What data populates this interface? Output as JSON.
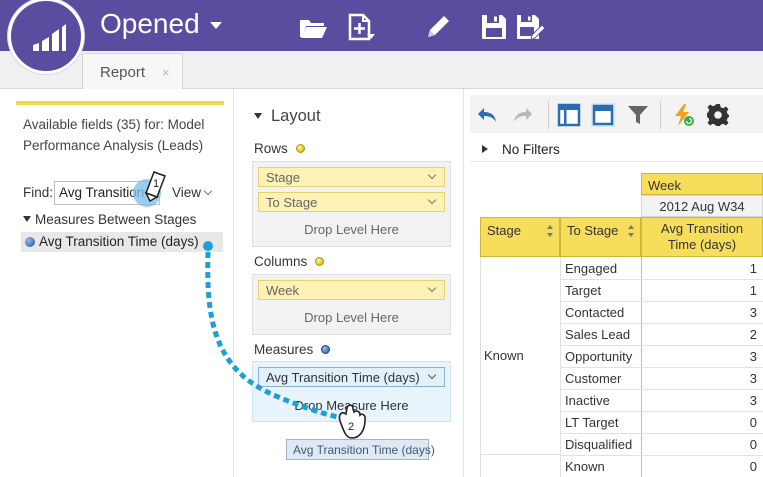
{
  "app": {
    "title": "Opened",
    "toolbar_icons": [
      "open-folder-icon",
      "new-report-icon",
      "edit-pencil-icon",
      "save-icon",
      "save-as-icon"
    ]
  },
  "tabs": [
    {
      "label": "Report",
      "close": "×"
    }
  ],
  "left_panel": {
    "available_text": "Available fields (35) for: Model Performance Analysis (Leads)",
    "find_label": "Find:",
    "find_value": "Avg Transition",
    "view_label": "View",
    "group_label": "Measures Between Stages",
    "field_label": "Avg Transition Time (days)"
  },
  "layout": {
    "title": "Layout",
    "rows_label": "Rows",
    "rows_items": [
      "Stage",
      "To Stage"
    ],
    "rows_drop": "Drop Level Here",
    "columns_label": "Columns",
    "columns_items": [
      "Week"
    ],
    "columns_drop": "Drop Level Here",
    "measures_label": "Measures",
    "measures_items": [
      "Avg Transition Time (days)"
    ],
    "measures_drop": "Drop Measure Here",
    "drag_ghost": "Avg Transition Time (days)"
  },
  "steps": {
    "step1": "1",
    "step2": "2"
  },
  "right_toolbar": {
    "icons": [
      "undo-icon",
      "redo-icon",
      "layout-view-icon",
      "grid-view-icon",
      "filter-icon",
      "lightning-refresh-icon",
      "settings-gear-icon"
    ],
    "filters_label": "No Filters"
  },
  "table": {
    "col_group_header": "Week",
    "col_value_header": "2012 Aug W34",
    "headers": {
      "stage": "Stage",
      "to_stage": "To Stage",
      "measure": "Avg Transition Time (days)"
    },
    "group_stage": "Known",
    "rows": [
      {
        "to_stage": "Engaged",
        "value": "1"
      },
      {
        "to_stage": "Target",
        "value": "1"
      },
      {
        "to_stage": "Contacted",
        "value": "3"
      },
      {
        "to_stage": "Sales Lead",
        "value": "2"
      },
      {
        "to_stage": "Opportunity",
        "value": "3"
      },
      {
        "to_stage": "Customer",
        "value": "3"
      },
      {
        "to_stage": "Inactive",
        "value": "3"
      },
      {
        "to_stage": "LT Target",
        "value": "0"
      },
      {
        "to_stage": "Disqualified",
        "value": "0"
      },
      {
        "to_stage": "Known",
        "value": "0"
      }
    ]
  },
  "colors": {
    "brand": "#5a4da0",
    "header_yellow": "#f6dd5c",
    "drag_path": "#1e9fd8"
  }
}
